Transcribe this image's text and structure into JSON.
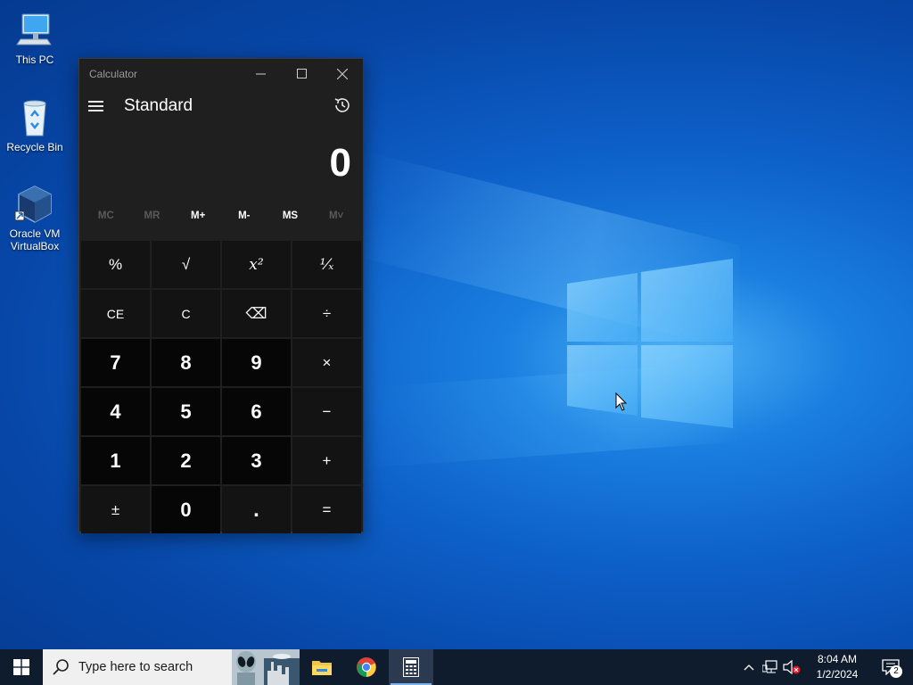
{
  "desktop": {
    "icons": [
      {
        "label": "This PC",
        "icon": "this-pc-icon"
      },
      {
        "label": "Recycle Bin",
        "icon": "recycle-bin-icon"
      },
      {
        "label": "Oracle VM VirtualBox",
        "icon": "virtualbox-icon"
      }
    ]
  },
  "calculator": {
    "window_title": "Calculator",
    "mode": "Standard",
    "display_value": "0",
    "memory_buttons": [
      "MC",
      "MR",
      "M+",
      "M-",
      "MS",
      "M˅"
    ],
    "keys": [
      {
        "label": "%",
        "kind": "op"
      },
      {
        "label": "√",
        "kind": "op"
      },
      {
        "label": "x²",
        "kind": "op"
      },
      {
        "label": "¹⁄ₓ",
        "kind": "op"
      },
      {
        "label": "CE",
        "kind": "op"
      },
      {
        "label": "C",
        "kind": "op"
      },
      {
        "label": "⌫",
        "kind": "op"
      },
      {
        "label": "÷",
        "kind": "op"
      },
      {
        "label": "7",
        "kind": "num"
      },
      {
        "label": "8",
        "kind": "num"
      },
      {
        "label": "9",
        "kind": "num"
      },
      {
        "label": "×",
        "kind": "op"
      },
      {
        "label": "4",
        "kind": "num"
      },
      {
        "label": "5",
        "kind": "num"
      },
      {
        "label": "6",
        "kind": "num"
      },
      {
        "label": "−",
        "kind": "op"
      },
      {
        "label": "1",
        "kind": "num"
      },
      {
        "label": "2",
        "kind": "num"
      },
      {
        "label": "3",
        "kind": "num"
      },
      {
        "label": "+",
        "kind": "op"
      },
      {
        "label": "±",
        "kind": "op"
      },
      {
        "label": "0",
        "kind": "num"
      },
      {
        "label": ".",
        "kind": "op"
      },
      {
        "label": "=",
        "kind": "op"
      }
    ]
  },
  "taskbar": {
    "search_placeholder": "Type here to search",
    "time": "8:04 AM",
    "date": "1/2/2024",
    "notification_count": "2"
  },
  "colors": {
    "taskbar_bg": "#0f1c2e",
    "calc_bg": "#1f1f1f",
    "accent": "#7ab4ea"
  }
}
